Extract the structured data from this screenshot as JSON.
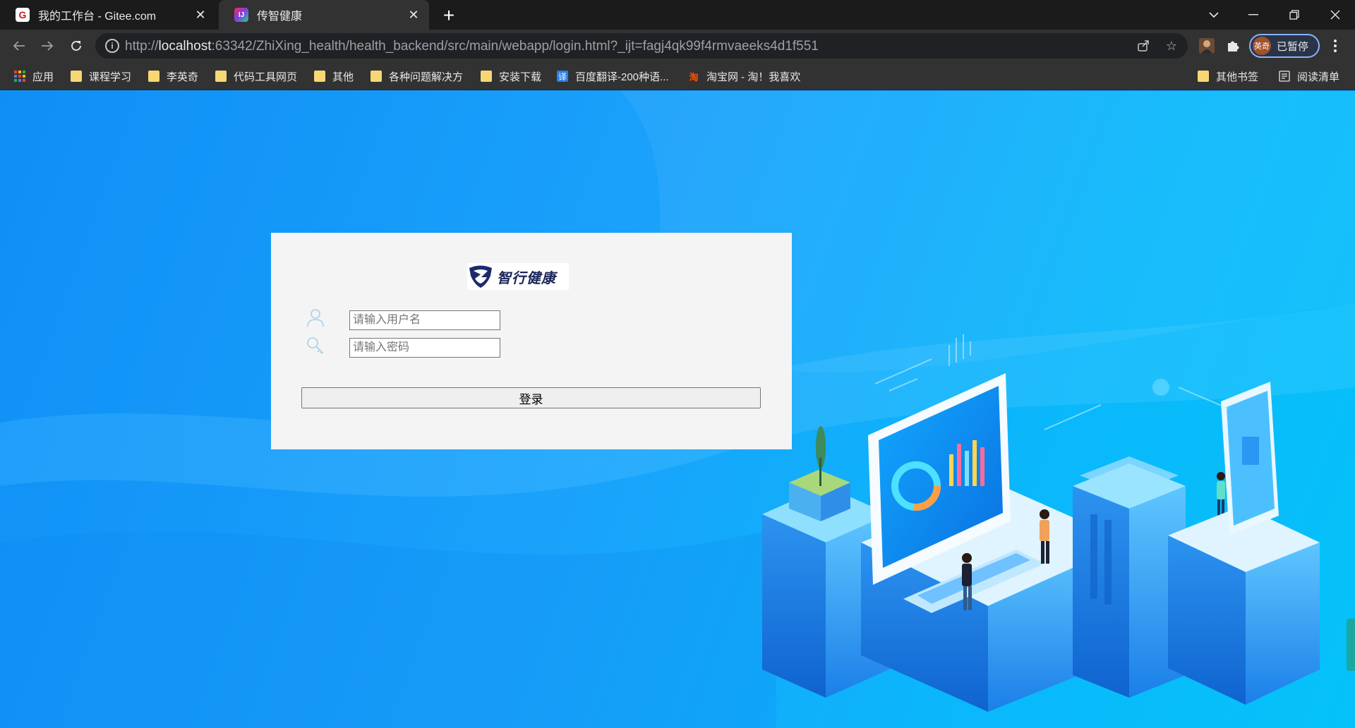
{
  "tabs": [
    {
      "title": "我的工作台 - Gitee.com",
      "favicon": "G",
      "favicon_color": "#c71d23",
      "active": false
    },
    {
      "title": "传智健康",
      "favicon": "IJ",
      "favicon_color": "#7b3fe4",
      "active": true
    }
  ],
  "toolbar": {
    "url_scheme": "http://",
    "url_host": "localhost",
    "url_rest": ":63342/ZhiXing_health/health_backend/src/main/webapp/login.html?_ijt=fagj4qk99f4rmvaeeks4d1f551",
    "profile_avatar": "英奇",
    "profile_status": "已暂停"
  },
  "bookmarks": [
    {
      "label": "应用",
      "icon": "apps-grid-icon"
    },
    {
      "label": "课程学习",
      "icon": "folder-icon"
    },
    {
      "label": "李英奇",
      "icon": "folder-icon"
    },
    {
      "label": "代码工具网页",
      "icon": "folder-icon"
    },
    {
      "label": "其他",
      "icon": "folder-icon"
    },
    {
      "label": "各种问题解决方",
      "icon": "folder-icon"
    },
    {
      "label": "安装下载",
      "icon": "folder-icon"
    },
    {
      "label": "百度翻译-200种语...",
      "icon": "baidu-translate-icon"
    },
    {
      "label": "淘宝网 - 淘！我喜欢",
      "icon": "taobao-icon"
    }
  ],
  "bookmarks_right": [
    {
      "label": "其他书签",
      "icon": "folder-icon"
    },
    {
      "label": "阅读清单",
      "icon": "reading-list-icon"
    }
  ],
  "login": {
    "logo_text": "智行健康",
    "username_placeholder": "请输入用户名",
    "password_placeholder": "请输入密码",
    "submit_label": "登录"
  },
  "colors": {
    "accent": "#8ab4f8",
    "page_background": "#0d9bff",
    "folder": "#f7d774"
  }
}
